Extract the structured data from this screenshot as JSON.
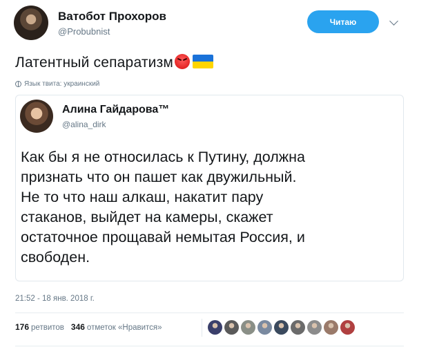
{
  "tweet": {
    "author_name": "Ватобот Прохоров",
    "author_handle": "@Probubnist",
    "follow_label": "Читаю",
    "text": "Латентный сепаратизм",
    "emoji": [
      "angry-face-emoji",
      "ukraine-flag-emoji"
    ],
    "language_note": "Язык твита: украинский",
    "timestamp": "21:52 - 18 янв. 2018 г."
  },
  "quoted": {
    "author_name": "Алина Гайдарова™",
    "author_handle": "@alina_dirk",
    "text": "Как бы я не относилась к Путину, должна\nпризнать что он пашет как  двужильный.\nНе то что наш алкаш, накатит пару\nстаканов, выйдет на  камеры, скажет\nостаточное прощавай немытая Россия, и\nсвободен."
  },
  "stats": {
    "retweets_count": "176",
    "retweets_label": "ретвитов",
    "likes_count": "346",
    "likes_label": "отметок «Нравится»",
    "liker_colors": [
      "#3a3f6b",
      "#5a5a5a",
      "#8a8f87",
      "#7a8aa0",
      "#3b4a5e",
      "#6b6b6b",
      "#8c8c8c",
      "#9a7a6a",
      "#b04040"
    ]
  },
  "colors": {
    "follow_button": "#2aa3ef",
    "muted_text": "#657786",
    "primary_text": "#14171a"
  }
}
